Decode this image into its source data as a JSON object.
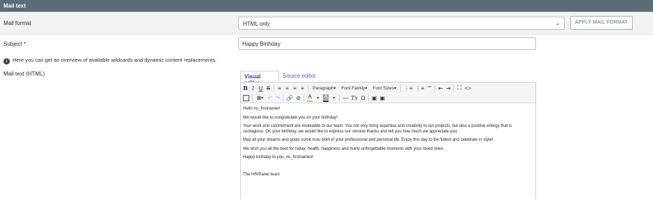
{
  "header": {
    "title": "Mail text"
  },
  "mail_format": {
    "label": "Mail format",
    "selected": "HTML only",
    "apply_label": "APPLY MAIL FORMAT"
  },
  "subject": {
    "label": "Subject *",
    "value": "Happy Birthday"
  },
  "info": {
    "icon": "info-icon",
    "text": "Here you can get an overview of available wildcards and dynamic content replacements."
  },
  "mail_text": {
    "label": "Mail text (HTML)",
    "tabs": [
      {
        "label": "Visual editor",
        "active": true
      },
      {
        "label": "Source editor",
        "active": false
      }
    ],
    "toolbar": {
      "bold": "B",
      "italic": "I",
      "underline": "U",
      "strike": "S",
      "paragraph": "Paragraph",
      "font_family": "Font Family",
      "font_sizes": "Font Sizes",
      "blockquote": "“”",
      "fullscreen": "⛶",
      "code": "<>",
      "text_color_letter": "A",
      "bg_color_letter": "A",
      "clear_format": "Tx",
      "omega": "Ω",
      "text_color": "#e8c31c",
      "bg_color": "#2b2b2b"
    },
    "content": [
      "Hello #u_firstname#",
      "We would like to congratulate you on your birthday!",
      "Your work and commitment are invaluable to our team. You not only bring expertise and creativity to our projects, but also a positive energy that is contagious. On your birthday, we would like to express our sincere thanks and tell you how much we appreciate you.",
      "May all your dreams and goals come true, both in your professional and personal life. Enjoy this day to the fullest and celebrate in style!",
      "We wish you all the best for today: health, happiness and many unforgettable moments with your loved ones.",
      "Happy birthday to you, #u_firstname#!",
      "",
      "The HR/Panel team"
    ]
  },
  "colors": {
    "header_bg": "#5c6b78",
    "tab_active_text": "#4a2fb0"
  }
}
